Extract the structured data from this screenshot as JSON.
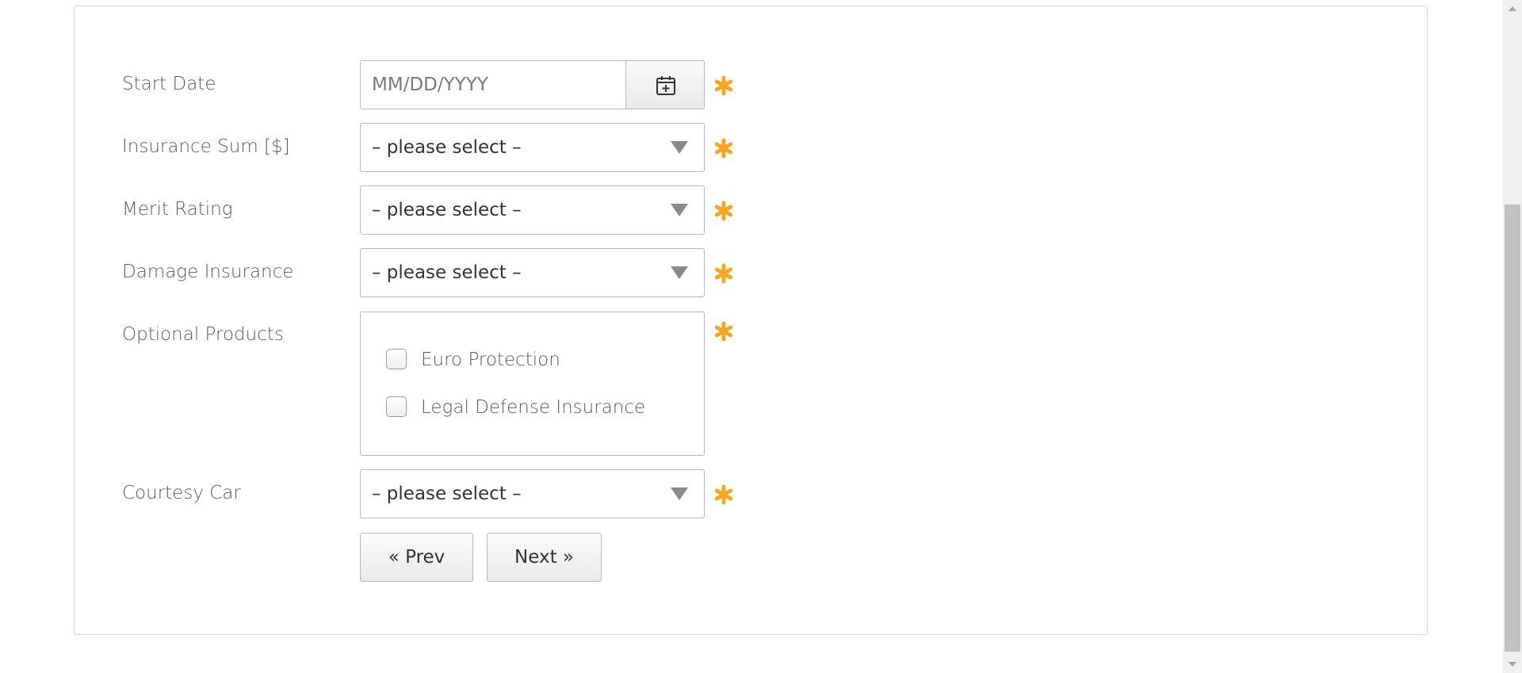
{
  "form": {
    "start_date": {
      "label": "Start Date",
      "placeholder": "MM/DD/YYYY",
      "value": ""
    },
    "insurance_sum": {
      "label": "Insurance Sum [$]",
      "selected": "– please select –"
    },
    "merit_rating": {
      "label": "Merit Rating",
      "selected": "– please select –"
    },
    "damage_insurance": {
      "label": "Damage Insurance",
      "selected": "– please select –"
    },
    "optional_products": {
      "label": "Optional Products",
      "options": [
        {
          "label": "Euro Protection",
          "checked": false
        },
        {
          "label": "Legal Defense Insurance",
          "checked": false
        }
      ]
    },
    "courtesy_car": {
      "label": "Courtesy Car",
      "selected": "– please select –"
    }
  },
  "buttons": {
    "prev_label": "« Prev",
    "next_label": "Next »"
  },
  "icons": {
    "calendar": "calendar-add-icon",
    "required": "asterisk-icon",
    "dropdown": "caret-down-icon"
  },
  "colors": {
    "required_accent": "#f5a623",
    "border": "#b9b9b9",
    "label_text": "#5b5b5b"
  }
}
